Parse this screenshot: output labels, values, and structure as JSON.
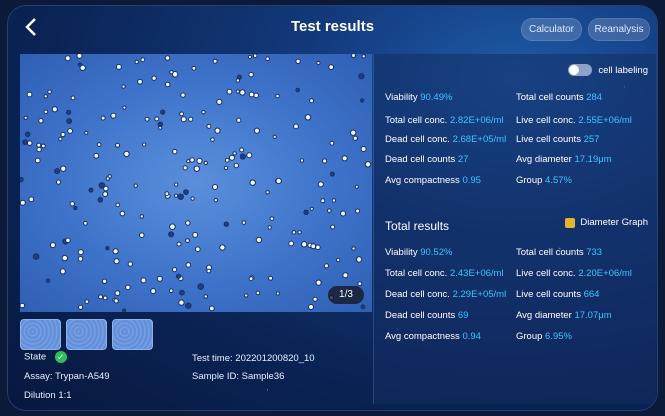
{
  "header": {
    "title": "Test results",
    "calculator_label": "Calculator",
    "reanalysis_label": "Reanalysis"
  },
  "image": {
    "counter": "1/3"
  },
  "info": {
    "state_label": "State",
    "assay": "Assay: Trypan-A549",
    "dilution": "Dilution 1:1",
    "test_time": "Test time: 202201200820_10",
    "sample_id": "Sample ID: Sample36"
  },
  "panel": {
    "cell_labeling": "cell labeling",
    "current": {
      "viability_label": "Viability",
      "viability": "90.49%",
      "total_counts_label": "Total cell counts",
      "total_counts": "284",
      "total_conc_label": "Total cell conc.",
      "total_conc": "2.82E+06/ml",
      "live_conc_label": "Live cell conc.",
      "live_conc": "2.55E+06/ml",
      "dead_conc_label": "Dead cell conc.",
      "dead_conc": "2.68E+05/ml",
      "live_counts_label": "Live cell counts",
      "live_counts": "257",
      "dead_counts_label": "Dead cell counts",
      "dead_counts": "27",
      "avg_diam_label": "Avg diameter",
      "avg_diam": "17.19μm",
      "avg_comp_label": "Avg compactness",
      "avg_comp": "0.95",
      "group_label": "Group",
      "group": "4.57%"
    },
    "total_title": "Total results",
    "diameter_graph": "Diameter Graph",
    "total": {
      "viability_label": "Viability",
      "viability": "90.52%",
      "total_counts_label": "Total cell counts",
      "total_counts": "733",
      "total_conc_label": "Total cell conc.",
      "total_conc": "2.43E+06/ml",
      "live_conc_label": "Live cell conc.",
      "live_conc": "2.20E+06/ml",
      "dead_conc_label": "Dead cell conc.",
      "dead_conc": "2.29E+05/ml",
      "live_counts_label": "Live cell counts",
      "live_counts": "664",
      "dead_counts_label": "Dead cell counts",
      "dead_counts": "69",
      "avg_diam_label": "Avg diameter",
      "avg_diam": "17.07μm",
      "avg_comp_label": "Avg compactness",
      "avg_comp": "0.94",
      "group_label": "Group",
      "group": "6.95%"
    }
  },
  "colors": {
    "value": "#3ec6ff",
    "accent": "#e3b52f",
    "ok": "#2fbf5a"
  }
}
